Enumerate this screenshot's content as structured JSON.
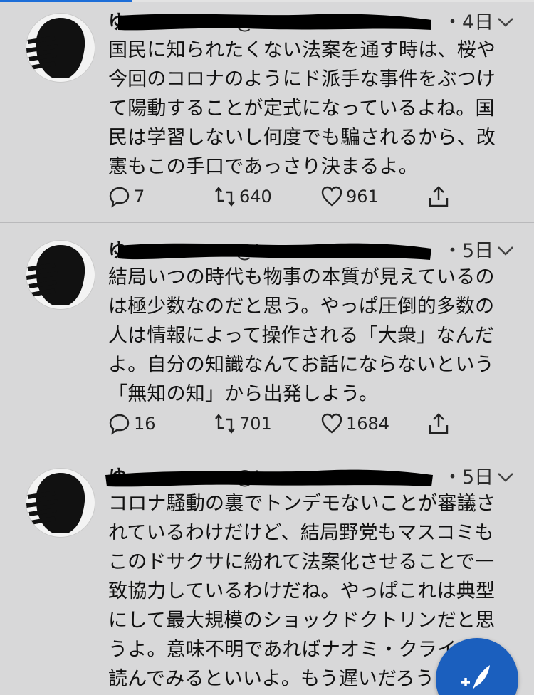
{
  "tweets": [
    {
      "name": "ゆ",
      "handle": "@t",
      "time": "・4日",
      "text": "国民に知られたくない法案を通す時は、桜や\n今回のコロナのようにド派手な事件をぶつけ\nて陽動することが定式になっているよね。国\n民は学習しないし何度でも騙されるから、改\n憲もこの手口であっさり決まるよ。",
      "replies": "7",
      "retweets": "640",
      "likes": "961"
    },
    {
      "name": "ゆ",
      "handle": "@t",
      "time": "・5日",
      "text": "結局いつの時代も物事の本質が見えているの\nは極少数なのだと思う。やっぱ圧倒的多数の\n人は情報によって操作される「大衆」なんだ\nよ。自分の知識なんてお話にならないという\n「無知の知」から出発しよう。",
      "replies": "16",
      "retweets": "701",
      "likes": "1684"
    },
    {
      "name": "ゆ",
      "handle": "@t",
      "time": "・5日",
      "text": "コロナ騒動の裏でトンデモないことが審議さ\nれているわけだけど、結局野党もマスコミも\nこのドサクサに紛れて法案化させることで一\n致協力しているわけだね。やっぱこれは典型\nにして最大規模のショックドクトリンだと思\nうよ。意味不明であればナオミ・クラインを\n読んでみるといいよ。もう遅いだろうけど。"
    }
  ],
  "icons": {
    "reply": "reply-icon",
    "retweet": "retweet-icon",
    "like": "heart-icon",
    "share": "share-icon",
    "compose": "compose-tweet-icon",
    "more": "chevron-down-icon"
  },
  "colors": {
    "accent": "#1b5fbe",
    "background": "#d8d8d9"
  }
}
